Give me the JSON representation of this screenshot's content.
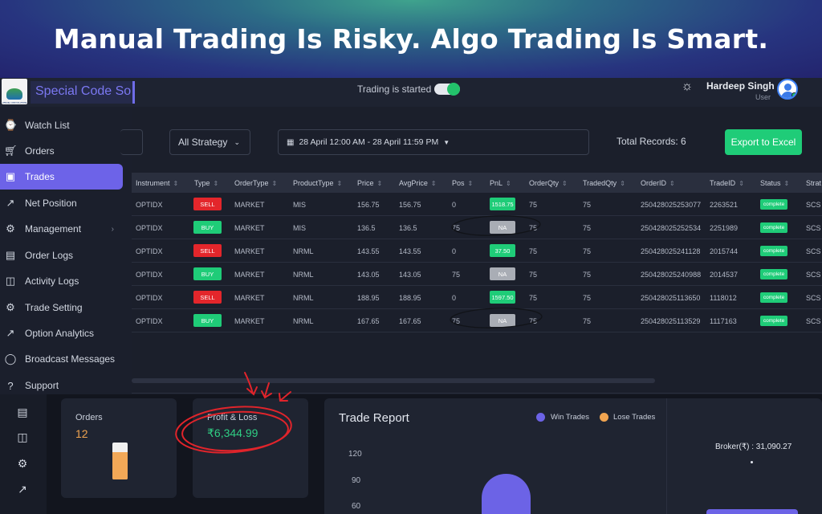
{
  "banner": {
    "headline": "Manual Trading Is Risky. Algo Trading Is Smart."
  },
  "header": {
    "logo_text": "SPECIAL CODE SOLUTIONS",
    "brand": "Special Code So",
    "trading_status": "Trading is started",
    "trading_enabled": true,
    "user_name": "Hardeep Singh",
    "user_role": "User"
  },
  "sidebar": {
    "items": [
      {
        "label": "Watch List",
        "icon": "watch-icon"
      },
      {
        "label": "Orders",
        "icon": "cart-icon"
      },
      {
        "label": "Trades",
        "icon": "wallet-icon",
        "active": true
      },
      {
        "label": "Net Position",
        "icon": "trend-icon"
      },
      {
        "label": "Management",
        "icon": "gear-icon",
        "has_submenu": true
      },
      {
        "label": "Order Logs",
        "icon": "document-icon"
      },
      {
        "label": "Activity Logs",
        "icon": "book-icon"
      },
      {
        "label": "Trade Setting",
        "icon": "gear-icon"
      },
      {
        "label": "Option Analytics",
        "icon": "trend-icon"
      },
      {
        "label": "Broadcast Messages",
        "icon": "chat-icon"
      },
      {
        "label": "Support",
        "icon": "help-icon"
      }
    ]
  },
  "filters": {
    "strategy": "All Strategy",
    "date_range": "28 April 12:00 AM - 28 April 11:59 PM",
    "total_records": "Total Records: 6",
    "export_label": "Export to Excel"
  },
  "table": {
    "headers": [
      "Instrument",
      "Type",
      "OrderType",
      "ProductType",
      "Price",
      "AvgPrice",
      "Pos",
      "PnL",
      "OrderQty",
      "TradedQty",
      "OrderID",
      "TradeID",
      "Status",
      "Strat"
    ],
    "rows": [
      {
        "instrument": "OPTIDX",
        "type": "SELL",
        "order_type": "MARKET",
        "product_type": "MIS",
        "price": "156.75",
        "avg_price": "156.75",
        "pos": "0",
        "pnl": "1518.75",
        "order_qty": "75",
        "traded_qty": "75",
        "order_id": "250428025253077",
        "trade_id": "2263521",
        "status": "complete",
        "strat": "SCS"
      },
      {
        "instrument": "OPTIDX",
        "type": "BUY",
        "order_type": "MARKET",
        "product_type": "MIS",
        "price": "136.5",
        "avg_price": "136.5",
        "pos": "75",
        "pnl": "NA",
        "order_qty": "75",
        "traded_qty": "75",
        "order_id": "250428025252534",
        "trade_id": "2251989",
        "status": "complete",
        "strat": "SCS"
      },
      {
        "instrument": "OPTIDX",
        "type": "SELL",
        "order_type": "MARKET",
        "product_type": "NRML",
        "price": "143.55",
        "avg_price": "143.55",
        "pos": "0",
        "pnl": "37.50",
        "order_qty": "75",
        "traded_qty": "75",
        "order_id": "250428025241128",
        "trade_id": "2015744",
        "status": "complete",
        "strat": "SCS"
      },
      {
        "instrument": "OPTIDX",
        "type": "BUY",
        "order_type": "MARKET",
        "product_type": "NRML",
        "price": "143.05",
        "avg_price": "143.05",
        "pos": "75",
        "pnl": "NA",
        "order_qty": "75",
        "traded_qty": "75",
        "order_id": "250428025240988",
        "trade_id": "2014537",
        "status": "complete",
        "strat": "SCS"
      },
      {
        "instrument": "OPTIDX",
        "type": "SELL",
        "order_type": "MARKET",
        "product_type": "NRML",
        "price": "188.95",
        "avg_price": "188.95",
        "pos": "0",
        "pnl": "1597.50",
        "order_qty": "75",
        "traded_qty": "75",
        "order_id": "250428025113650",
        "trade_id": "1118012",
        "status": "complete",
        "strat": "SCS"
      },
      {
        "instrument": "OPTIDX",
        "type": "BUY",
        "order_type": "MARKET",
        "product_type": "NRML",
        "price": "167.65",
        "avg_price": "167.65",
        "pos": "75",
        "pnl": "NA",
        "order_qty": "75",
        "traded_qty": "75",
        "order_id": "250428025113529",
        "trade_id": "1117163",
        "status": "complete",
        "strat": "SCS"
      }
    ]
  },
  "summary": {
    "orders_label": "Orders",
    "orders_value": "12",
    "orders_fill_fraction": 0.75,
    "pnl_label": "Profit & Loss",
    "pnl_value": "₹6,344.99"
  },
  "report": {
    "title": "Trade Report",
    "legend_win": "Win Trades",
    "legend_lose": "Lose Trades",
    "win_color": "#6c63e6",
    "lose_color": "#f0a450",
    "yticks": [
      "120",
      "90",
      "60"
    ],
    "broker": "Broker(₹) : 31,090.27"
  },
  "colors": {
    "accent": "#6d63e8",
    "buy": "#1fcc78",
    "sell": "#e3262b",
    "annotation": "#e0242b"
  }
}
